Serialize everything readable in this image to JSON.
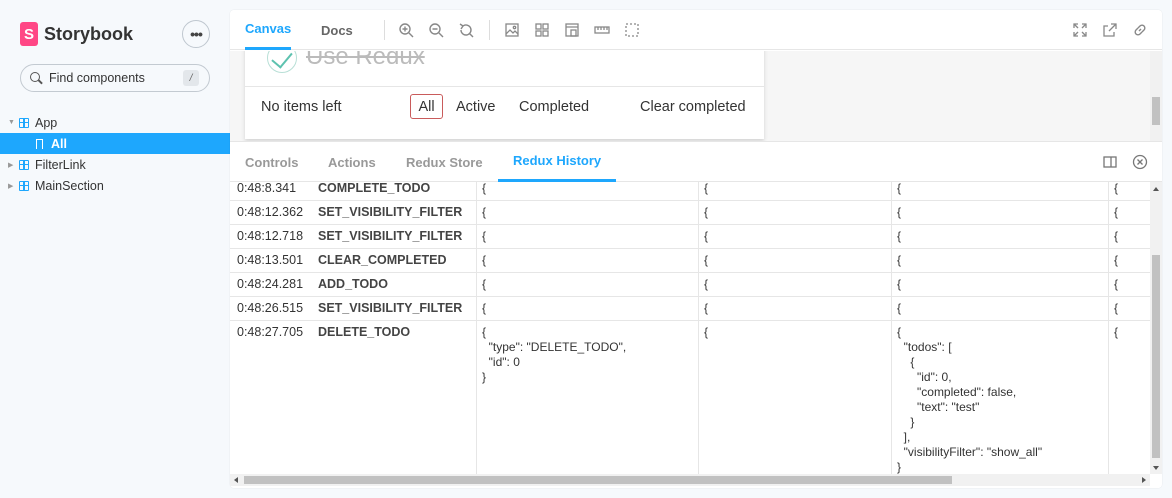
{
  "sidebar": {
    "brand_logo": "S",
    "brand_name": "Storybook",
    "menu_icon": "•••",
    "search_placeholder": "Find components",
    "search_shortcut": "/",
    "tree": [
      {
        "label": "App",
        "expanded": true
      },
      {
        "label": "All",
        "selected": true
      },
      {
        "label": "FilterLink",
        "expanded": false
      },
      {
        "label": "MainSection",
        "expanded": false
      }
    ]
  },
  "toolbar": {
    "tabs": [
      {
        "label": "Canvas",
        "active": true
      },
      {
        "label": "Docs",
        "active": false
      }
    ],
    "icons": [
      "zoom-in-icon",
      "zoom-out-icon",
      "zoom-reset-icon",
      "background-icon",
      "grid-icon",
      "viewport-icon",
      "measure-icon",
      "outline-icon",
      "fullscreen-icon",
      "open-new-tab-icon",
      "copy-link-icon"
    ]
  },
  "preview": {
    "todo_text": "Use Redux",
    "items_left": "No items left",
    "filter_all": "All",
    "filter_active": "Active",
    "filter_completed": "Completed",
    "clear_completed": "Clear completed"
  },
  "addons": {
    "tabs": [
      {
        "label": "Controls",
        "active": false
      },
      {
        "label": "Actions",
        "active": false
      },
      {
        "label": "Redux Store",
        "active": false
      },
      {
        "label": "Redux History",
        "active": true
      }
    ],
    "history": [
      {
        "time": "0:48:8.341",
        "action": "COMPLETE_TODO",
        "c1": "{",
        "c2": "{",
        "c3": "{",
        "c4": "{"
      },
      {
        "time": "0:48:12.362",
        "action": "SET_VISIBILITY_FILTER",
        "c1": "{",
        "c2": "{",
        "c3": "{",
        "c4": "{"
      },
      {
        "time": "0:48:12.718",
        "action": "SET_VISIBILITY_FILTER",
        "c1": "{",
        "c2": "{",
        "c3": "{",
        "c4": "{"
      },
      {
        "time": "0:48:13.501",
        "action": "CLEAR_COMPLETED",
        "c1": "{",
        "c2": "{",
        "c3": "{",
        "c4": "{"
      },
      {
        "time": "0:48:24.281",
        "action": "ADD_TODO",
        "c1": "{",
        "c2": "{",
        "c3": "{",
        "c4": "{"
      },
      {
        "time": "0:48:26.515",
        "action": "SET_VISIBILITY_FILTER",
        "c1": "{",
        "c2": "{",
        "c3": "{",
        "c4": "{"
      },
      {
        "time": "0:48:27.705",
        "action": "DELETE_TODO",
        "c1": "{\n  \"type\": \"DELETE_TODO\",\n  \"id\": 0\n}",
        "c2": "{",
        "c3": "{\n  \"todos\": [\n    {\n      \"id\": 0,\n      \"completed\": false,\n      \"text\": \"test\"\n    }\n  ],\n  \"visibilityFilter\": \"show_all\"\n}",
        "c4": "{"
      }
    ]
  },
  "colors": {
    "accent": "#1ea7fd",
    "brand": "#ff4785",
    "filter_border": "#c95b5b"
  }
}
